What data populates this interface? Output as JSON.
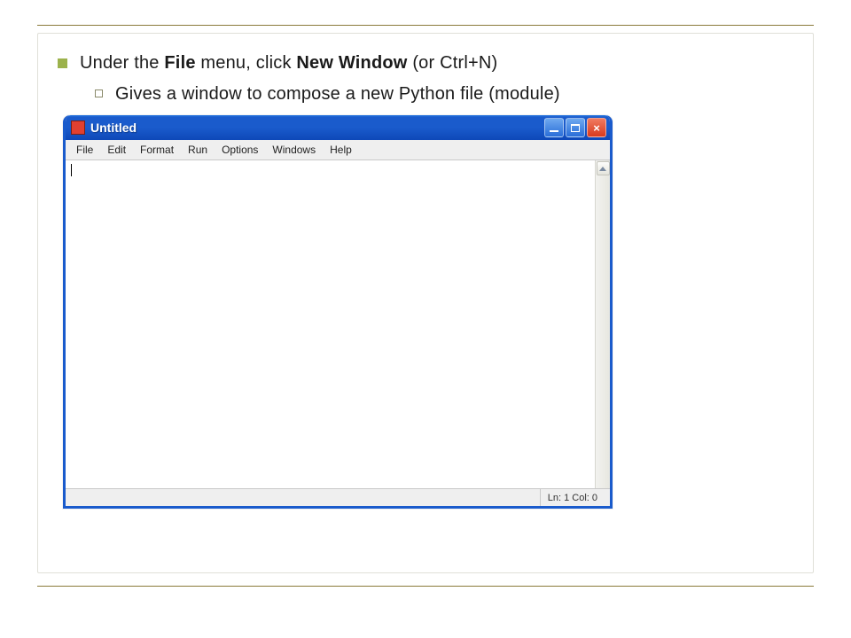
{
  "bullets": {
    "main_prefix": "Under the ",
    "main_bold1": "File",
    "main_mid": " menu, click ",
    "main_bold2": "New Window",
    "main_suffix": " (or Ctrl+N)",
    "sub": "Gives a window to compose a new Python file (module)"
  },
  "window": {
    "title": "Untitled",
    "menus": {
      "file": "File",
      "edit": "Edit",
      "format": "Format",
      "run": "Run",
      "options": "Options",
      "windows": "Windows",
      "help": "Help"
    },
    "status": "Ln: 1 Col: 0"
  }
}
